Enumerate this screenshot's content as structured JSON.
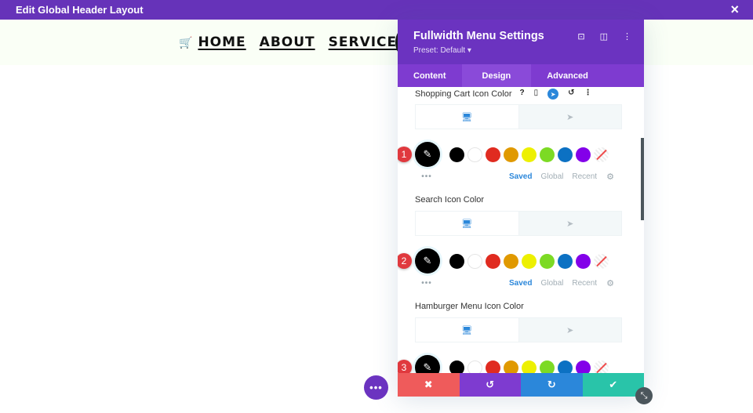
{
  "topbar": {
    "title": "Edit Global Header Layout",
    "close_icon": "×"
  },
  "nav": {
    "cart_icon": "🛒",
    "items": [
      "HOME",
      "ABOUT",
      "SERVICES"
    ],
    "services_chevron": "⌄"
  },
  "panel": {
    "title": "Fullwidth Menu Settings",
    "preset": "Preset: Default ▾",
    "head_icons": {
      "focus": "⊡",
      "split": "◫",
      "more": "⋮"
    },
    "tabs": [
      {
        "label": "Content",
        "active": false
      },
      {
        "label": "Design",
        "active": true
      },
      {
        "label": "Advanced",
        "active": false
      }
    ],
    "field_icons": {
      "help": "?",
      "device": "▯",
      "hover": "➤",
      "reset": "↺",
      "more": "⋮"
    },
    "sections": [
      {
        "label": "Shopping Cart Icon Color",
        "badge": "1"
      },
      {
        "label": "Search Icon Color",
        "badge": "2"
      },
      {
        "label": "Hamburger Menu Icon Color",
        "badge": "3"
      }
    ],
    "device_tabs": {
      "desktop_icon": "🖥",
      "hover_icon": "➤"
    },
    "picker_icon": "✎",
    "swatches": [
      "#000000",
      "#ffffff",
      "#e02b20",
      "#e09900",
      "#edf000",
      "#7cda24",
      "#0c71c3",
      "#8300e9",
      "none"
    ],
    "palette_tabs": [
      "Saved",
      "Global",
      "Recent"
    ],
    "palette_active": "Saved",
    "dots": "•••",
    "gear_icon": "⚙"
  },
  "bottom_bar": {
    "cancel": "✖",
    "undo": "↺",
    "redo": "↻",
    "save": "✔"
  },
  "fab": "•••",
  "resize_icon": "⤡",
  "colors": {
    "purple": "#6b33c0",
    "blue": "#2b87da",
    "red": "#ef5b5b",
    "green": "#29c4a9"
  }
}
